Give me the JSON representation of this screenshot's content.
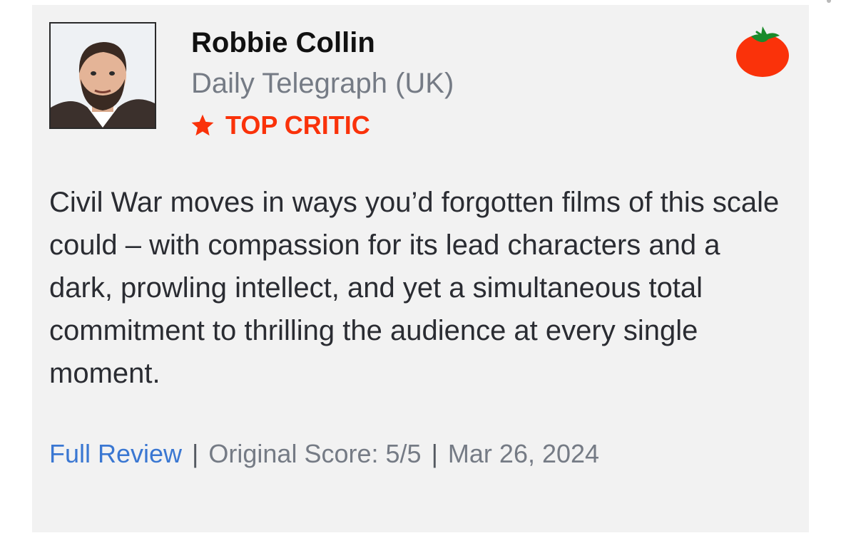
{
  "review": {
    "critic_name": "Robbie Collin",
    "publication": "Daily Telegraph (UK)",
    "badge_label": "TOP CRITIC",
    "badge_icon": "star-icon",
    "rating_icon": "fresh-tomato-icon",
    "quote": "Civil War moves in ways you’d forgotten films of this scale could – with compassion for its lead characters and a dark, prowling intellect, and yet a simultaneous total commitment to thrilling the audience at every single moment.",
    "full_review_label": "Full Review",
    "separator": "|",
    "original_score": "Original Score: 5/5",
    "date": "Mar 26, 2024"
  },
  "colors": {
    "card_background": "#f2f2f2",
    "top_critic_red": "#fa320a",
    "link_blue": "#3a77d2",
    "muted_text": "#757b85",
    "tomato_red": "#fa320a",
    "tomato_leaf": "#1a8a2b"
  }
}
